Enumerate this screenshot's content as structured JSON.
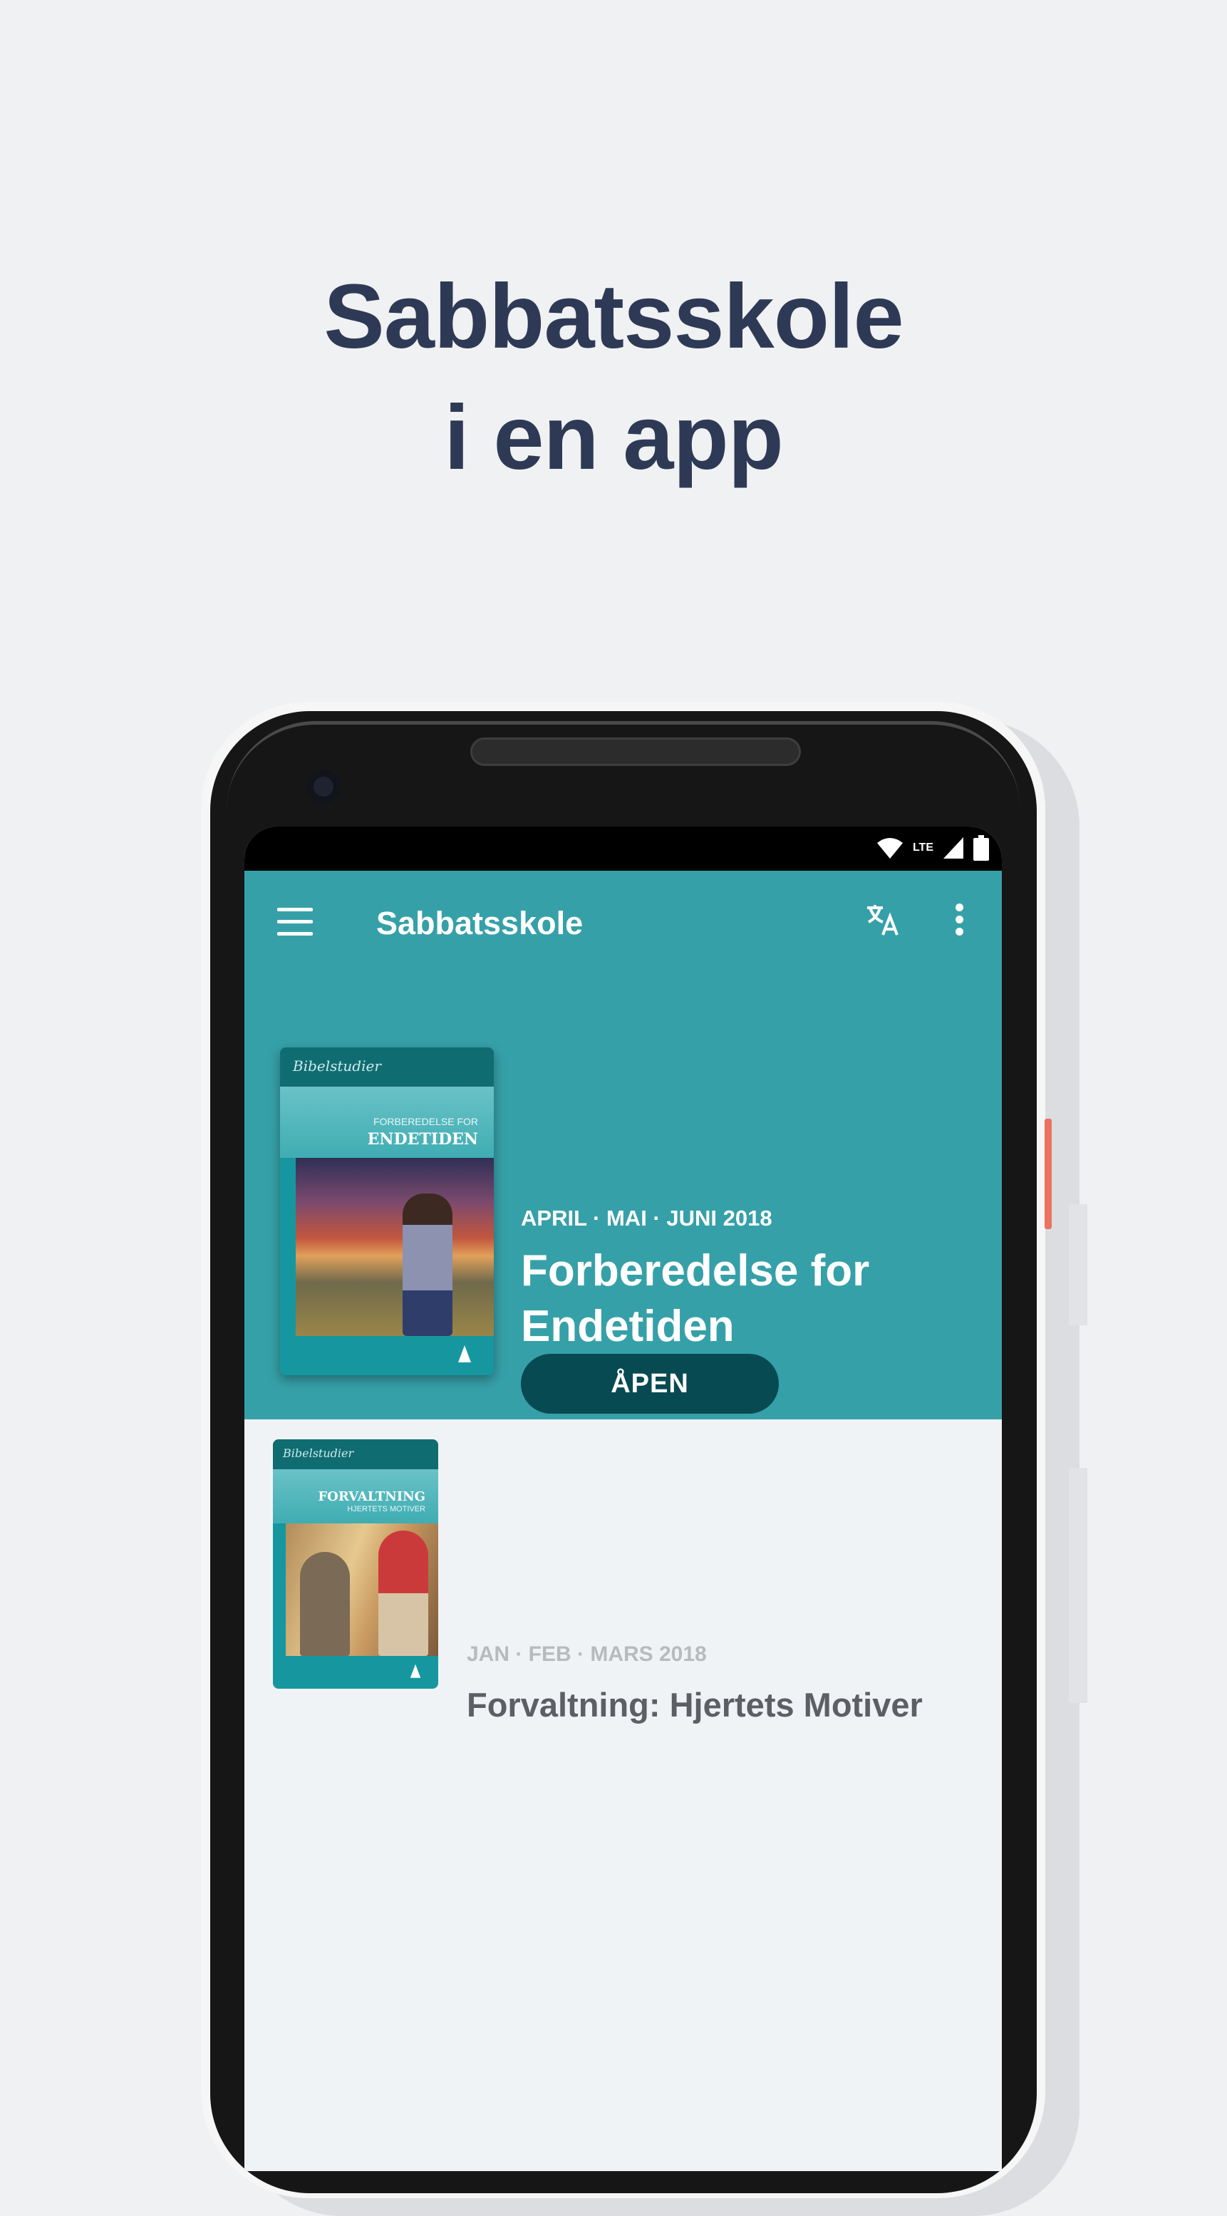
{
  "headline": {
    "line1": "Sabbatsskole",
    "line2": "i en app"
  },
  "status_bar": {
    "network": "LTE",
    "icons": [
      "wifi-icon",
      "signal-icon",
      "battery-icon"
    ]
  },
  "app_bar": {
    "title": "Sabbatsskole",
    "icons": [
      "menu-icon",
      "translate-icon",
      "more-vert-icon"
    ]
  },
  "featured": {
    "date": "APRIL · MAI · JUNI 2018",
    "title": "Forberedelse for Endetiden",
    "button_label": "ÅPEN",
    "cover": {
      "brand": "Bibelstudier",
      "subtitle": "FORBEREDELSE FOR",
      "title": "ENDETIDEN"
    }
  },
  "quarterlies": [
    {
      "date": "JAN · FEB · MARS 2018",
      "title": "Forvaltning: Hjertets Motiver",
      "cover": {
        "brand": "Bibelstudier",
        "title": "FORVALTNING",
        "subtitle": "HJERTETS MOTIVER"
      }
    }
  ],
  "colors": {
    "primary": "#36a0a8",
    "button": "#084a52",
    "headline": "#2e3a55",
    "background": "#f0f1f3"
  }
}
